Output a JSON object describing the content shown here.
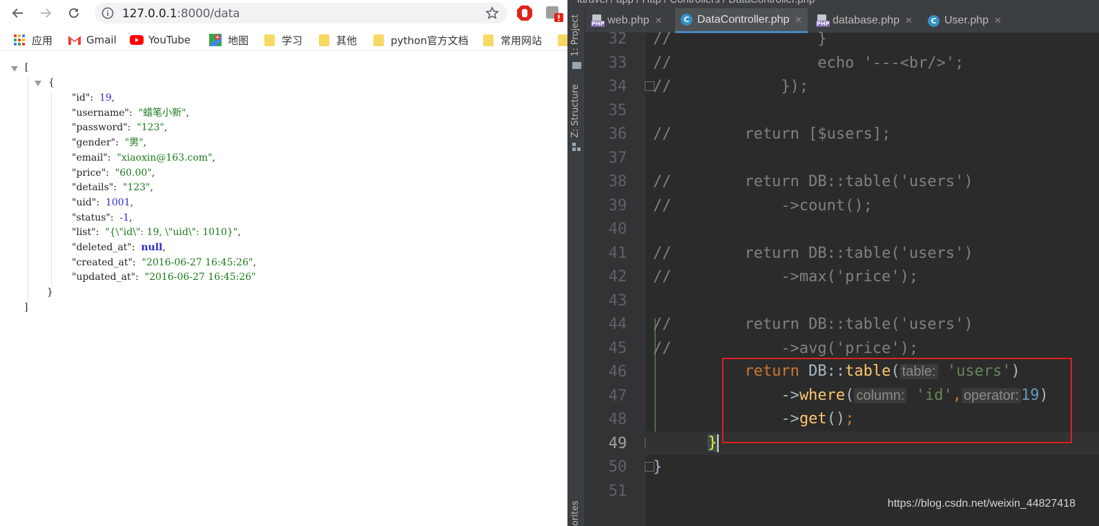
{
  "browser": {
    "url_host": "127.0.0.1",
    "url_path": ":8000/data",
    "bookmarks": [
      {
        "label": "应用",
        "icon": "apps-grid-icon"
      },
      {
        "label": "Gmail",
        "icon": "gmail-icon"
      },
      {
        "label": "YouTube",
        "icon": "youtube-icon"
      },
      {
        "label": "地图",
        "icon": "maps-icon"
      },
      {
        "label": "学习",
        "icon": "folder-icon"
      },
      {
        "label": "其他",
        "icon": "folder-icon"
      },
      {
        "label": "python官方文档",
        "icon": "folder-icon"
      },
      {
        "label": "常用网站",
        "icon": "folder-icon"
      }
    ],
    "json": {
      "open_bracket": "[",
      "open_brace": "{",
      "close_brace": "}",
      "close_bracket": "]",
      "fields": [
        {
          "key": "\"id\":",
          "value": "19",
          "type": "num"
        },
        {
          "key": "\"username\":",
          "value": "\"蜡笔小新\"",
          "type": "str"
        },
        {
          "key": "\"password\":",
          "value": "\"123\"",
          "type": "str"
        },
        {
          "key": "\"gender\":",
          "value": "\"男\"",
          "type": "str"
        },
        {
          "key": "\"email\":",
          "value": "\"xiaoxin@163.com\"",
          "type": "str"
        },
        {
          "key": "\"price\":",
          "value": "\"60.00\"",
          "type": "str"
        },
        {
          "key": "\"details\":",
          "value": "\"123\"",
          "type": "str"
        },
        {
          "key": "\"uid\":",
          "value": "1001",
          "type": "num"
        },
        {
          "key": "\"status\":",
          "value": "-1",
          "type": "num"
        },
        {
          "key": "\"list\":",
          "value": "\"{\\\"id\\\": 19, \\\"uid\\\": 1010}\"",
          "type": "str"
        },
        {
          "key": "\"deleted_at\":",
          "value": "null",
          "type": "null"
        },
        {
          "key": "\"created_at\":",
          "value": "\"2016-06-27 16:45:26\"",
          "type": "str"
        },
        {
          "key": "\"updated_at\":",
          "value": "\"2016-06-27 16:45:26\"",
          "type": "str"
        }
      ]
    }
  },
  "ide": {
    "breadcrumb": "laravel / app / Http / Controllers / DataController.php",
    "tabs": [
      {
        "label": "web.php",
        "icon": "php-file-icon",
        "active": false
      },
      {
        "label": "DataController.php",
        "icon": "class-icon",
        "active": true
      },
      {
        "label": "database.php",
        "icon": "php-file-icon",
        "active": false
      },
      {
        "label": "User.php",
        "icon": "class-icon",
        "active": false
      }
    ],
    "side_labels": {
      "project": "1: Project",
      "structure": "Z: Structure",
      "favorites": "orites"
    },
    "lines": [
      {
        "n": "32",
        "text": "//                }"
      },
      {
        "n": "33",
        "text": "//                echo '---<br/>';"
      },
      {
        "n": "34",
        "text": "//            });"
      },
      {
        "n": "35",
        "text": ""
      },
      {
        "n": "36",
        "text": "//        return [$users];"
      },
      {
        "n": "37",
        "text": ""
      },
      {
        "n": "38",
        "text": "//        return DB::table('users')"
      },
      {
        "n": "39",
        "text": "//            ->count();"
      },
      {
        "n": "40",
        "text": ""
      },
      {
        "n": "41",
        "text": "//        return DB::table('users')"
      },
      {
        "n": "42",
        "text": "//            ->max('price');"
      },
      {
        "n": "43",
        "text": ""
      },
      {
        "n": "44",
        "text": "//        return DB::table('users')"
      },
      {
        "n": "45",
        "text": "//            ->avg('price');"
      },
      {
        "n": "46",
        "text": ""
      },
      {
        "n": "47",
        "text": ""
      },
      {
        "n": "48",
        "text": ""
      },
      {
        "n": "49",
        "text": ""
      },
      {
        "n": "50",
        "text": "}"
      },
      {
        "n": "51",
        "text": ""
      }
    ],
    "code46": {
      "kw": "return",
      "cls": " DB::",
      "fn": "table",
      "open": "(",
      "hint": "table:",
      "arg": "'users'",
      "close": ")"
    },
    "code47": {
      "arrow": "->",
      "fn": "where",
      "open": "(",
      "hint1": "column:",
      "arg1": "'id'",
      "comma": ",",
      "hint2": "operator:",
      "arg2": "19",
      "close": ")"
    },
    "code48": {
      "arrow": "->",
      "fn": "get",
      "parens": "()",
      "semi": ";"
    },
    "code49": {
      "brace": "}"
    },
    "watermark": "https://blog.csdn.net/weixin_44827418"
  }
}
